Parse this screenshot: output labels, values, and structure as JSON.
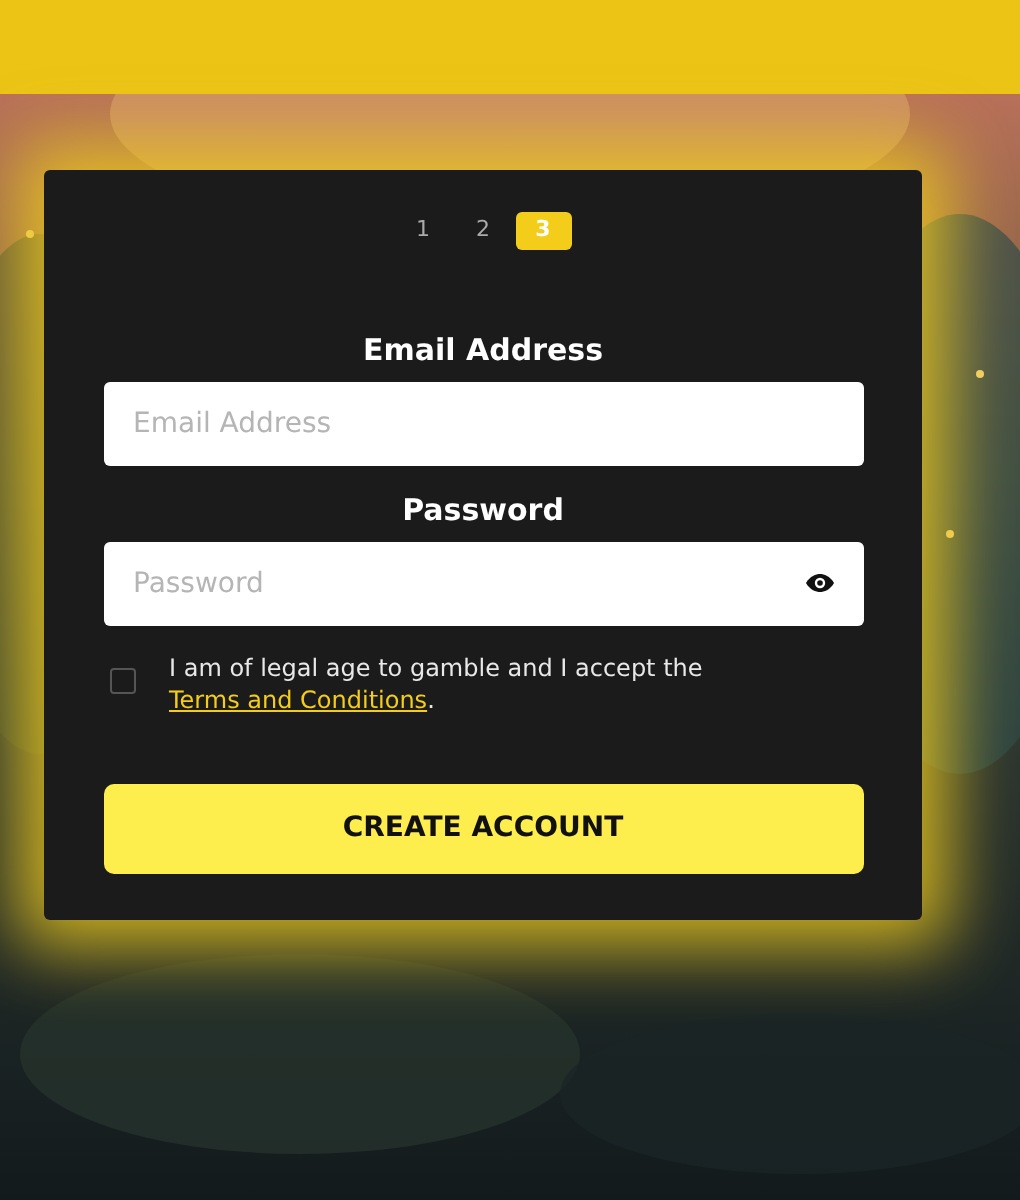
{
  "steps": [
    {
      "label": "1",
      "selected": false
    },
    {
      "label": "2",
      "selected": false
    },
    {
      "label": "3",
      "selected": true
    }
  ],
  "fields": [
    {
      "kind": "email",
      "label": "Email Address",
      "placeholder": "Email Address"
    },
    {
      "kind": "password",
      "label": "Password",
      "placeholder": "Password"
    }
  ],
  "consent": {
    "checked": false,
    "text": "I am of legal age to gamble and I accept the",
    "link": "Terms and Conditions",
    "end": "."
  },
  "button": "CREATE ACCOUNT"
}
